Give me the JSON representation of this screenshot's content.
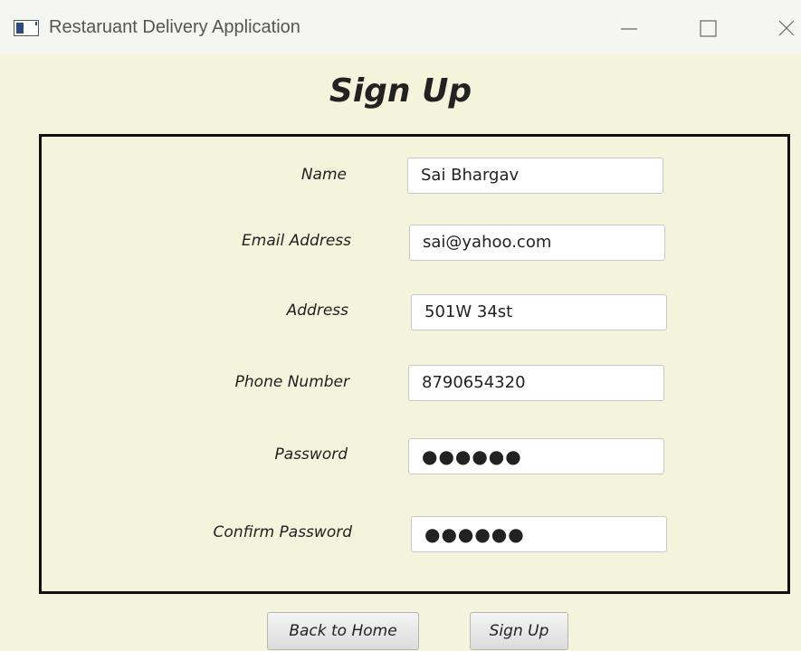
{
  "window": {
    "title": "Restaruant Delivery Application",
    "icon": "application-window-icon",
    "controls": [
      "minimize-icon",
      "maximize-icon",
      "close-icon"
    ]
  },
  "page": {
    "title": "Sign Up"
  },
  "form": {
    "name": {
      "label": "Name",
      "value": "Sai Bhargav"
    },
    "email": {
      "label": "Email Address",
      "value": "sai@yahoo.com"
    },
    "address": {
      "label": "Address",
      "value": "501W 34st"
    },
    "phone": {
      "label": "Phone Number",
      "value": "8790654320"
    },
    "password": {
      "label": "Password",
      "value": "●●●●●●"
    },
    "confirm_password": {
      "label": "Confirm Password",
      "value": "●●●●●●"
    }
  },
  "buttons": {
    "back": "Back to Home",
    "signup": "Sign Up"
  },
  "colors": {
    "background": "#f4f3dc",
    "titlebar": "#f5f5f1",
    "border": "#111111"
  }
}
